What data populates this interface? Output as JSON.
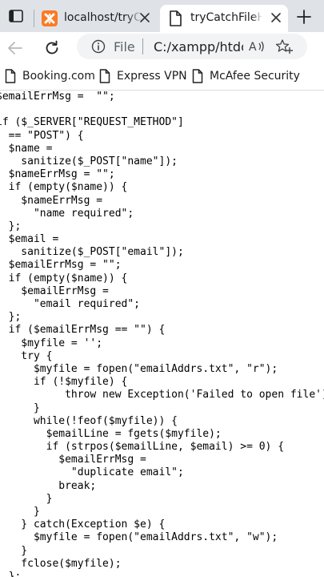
{
  "browser": {
    "tabs": [
      {
        "title": "localhost/tryCatchFileHandling.php",
        "active": false,
        "favicon": "xampp-icon"
      },
      {
        "title": "tryCatchFileHandling.php",
        "active": true,
        "favicon": "document-icon"
      }
    ],
    "address_bar": {
      "scheme_label": "File",
      "url": "C:/xampp/htdocs/tryCatchFileHandling.php"
    },
    "favorites": [
      {
        "label": "Booking.com",
        "icon": "page-icon"
      },
      {
        "label": "Express VPN",
        "icon": "page-icon"
      },
      {
        "label": "McAfee Security",
        "icon": "page-icon"
      }
    ]
  },
  "code_lines": [
    "$emailErrMsg =  \"\";",
    "",
    "if ($_SERVER[\"REQUEST_METHOD\"]",
    "  == \"POST\") {",
    "  $name =",
    "    sanitize($_POST[\"name\"]);",
    "  $nameErrMsg = \"\";",
    "  if (empty($name)) {",
    "    $nameErrMsg =",
    "      \"name required\";",
    "  };",
    "  $email =",
    "    sanitize($_POST[\"email\"]);",
    "  $emailErrMsg = \"\";",
    "  if (empty($name)) {",
    "    $emailErrMsg =",
    "      \"email required\";",
    "  };",
    "  if ($emailErrMsg == \"\") {",
    "    $myfile = '';",
    "    try {",
    "      $myfile = fopen(\"emailAddrs.txt\", \"r\");",
    "      if (!$myfile) {",
    "           throw new Exception('Failed to open file')",
    "      }",
    "      while(!feof($myfile)) {",
    "        $emailLine = fgets($myfile);",
    "        if (strpos($emailLine, $email) >= 0) {",
    "          $emailErrMsg =",
    "            \"duplicate email\";",
    "          break;",
    "        }",
    "      }",
    "    } catch(Exception $e) {",
    "      $myfile = fopen(\"emailAddrs.txt\", \"w\");",
    "    }",
    "    fclose($myfile);",
    "  };"
  ]
}
